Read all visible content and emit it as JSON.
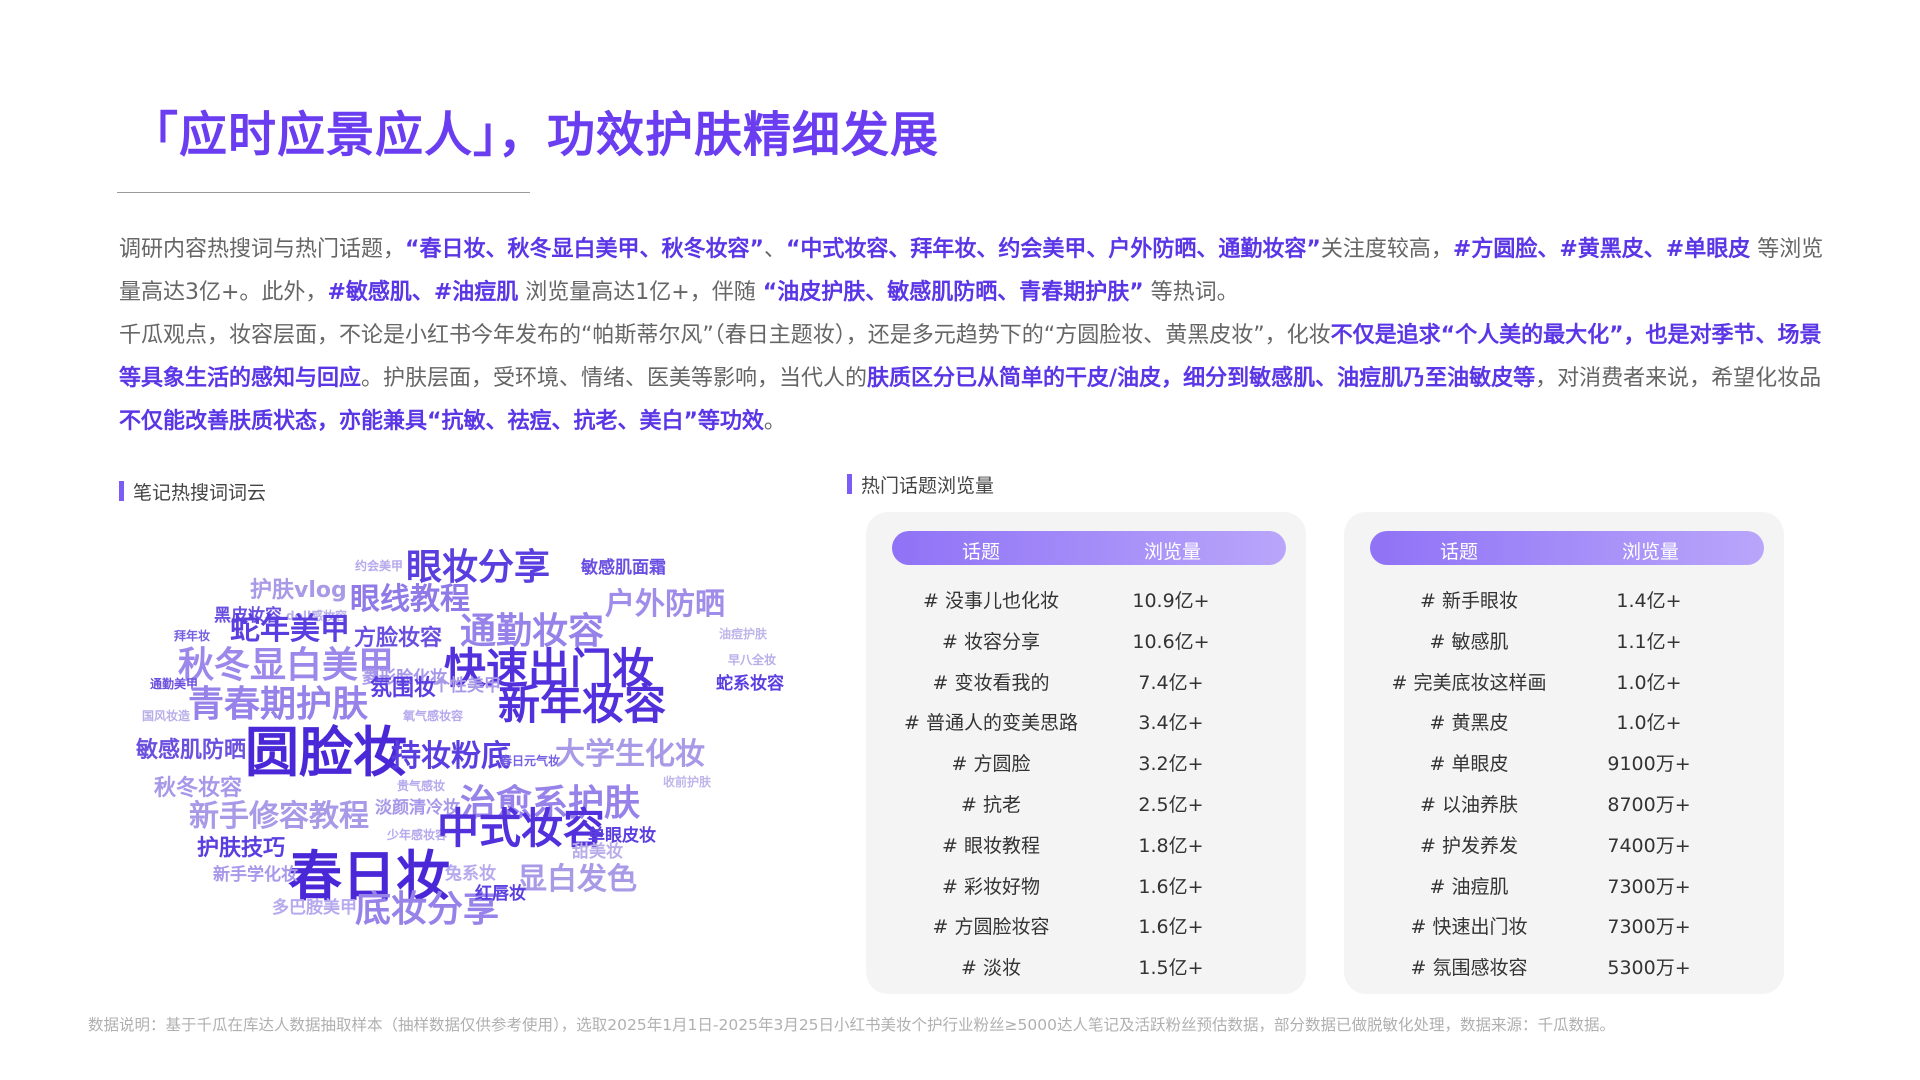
{
  "title": "「应时应景应人」，功效护肤精细发展",
  "intro": {
    "p1": [
      {
        "t": "调研内容热搜词与热门话题，",
        "hl": false
      },
      {
        "t": "“春日妆、秋冬显白美甲、秋冬妆容”",
        "hl": true
      },
      {
        "t": "、",
        "hl": false
      },
      {
        "t": "“中式妆容、拜年妆、约会美甲、户外防晒、通勤妆容”",
        "hl": true
      },
      {
        "t": "关注度较高，",
        "hl": false
      },
      {
        "t": "#方圆脸、#黄黑皮、#单眼皮",
        "hl": true
      },
      {
        "t": " 等浏览量高达3亿+。此外，",
        "hl": false
      },
      {
        "t": "#敏感肌、#油痘肌",
        "hl": true
      },
      {
        "t": " 浏览量高达1亿+，伴随 ",
        "hl": false
      },
      {
        "t": "“油皮护肤、敏感肌防晒、青春期护肤”",
        "hl": true
      },
      {
        "t": " 等热词。",
        "hl": false
      }
    ],
    "p2": [
      {
        "t": "千瓜观点，妆容层面，不论是小红书今年发布的“帕斯蒂尔风”（春日主题妆），还是多元趋势下的“方圆脸妆、黄黑皮妆”，化妆",
        "hl": false
      },
      {
        "t": "不仅是追求“个人美的最大化”，也是对季节、场景等具象生活的感知与回应",
        "hl": true
      },
      {
        "t": "。护肤层面，受环境、情绪、医美等影响，当代人的",
        "hl": false
      },
      {
        "t": "肤质区分已从简单的干皮/油皮，细分到敏感肌、油痘肌乃至油敏皮等",
        "hl": true
      },
      {
        "t": "，对消费者来说，希望化妆品",
        "hl": false
      },
      {
        "t": "不仅能改善肤质状态，亦能兼具“抗敏、祛痘、抗老、美白”等功效",
        "hl": true
      },
      {
        "t": "。",
        "hl": false
      }
    ]
  },
  "cloud_label": "笔记热搜词词云",
  "topics_label": "热门话题浏览量",
  "word_cloud": [
    {
      "text": "眼妆分享",
      "color": "#5b3ee0",
      "level": 5
    },
    {
      "text": "约会美甲",
      "color": "#b6a9ee",
      "level": 1
    },
    {
      "text": "敏感肌面霜",
      "color": "#6a4fe2",
      "level": 2
    },
    {
      "text": "护肤vlog",
      "color": "#a99ae8",
      "level": 3
    },
    {
      "text": "眼线教程",
      "color": "#8f7ae8",
      "level": 4
    },
    {
      "text": "户外防晒",
      "color": "#a08de9",
      "level": 4
    },
    {
      "text": "黑皮妆容",
      "color": "#6b50e0",
      "level": 2
    },
    {
      "text": "doll感妆容",
      "color": "#b9afe9",
      "level": 1
    },
    {
      "text": "通勤妆容",
      "color": "#9682e9",
      "level": 5
    },
    {
      "text": "拜年妆",
      "color": "#7560e2",
      "level": 1
    },
    {
      "text": "蛇年美甲",
      "color": "#5b3ee0",
      "level": 4
    },
    {
      "text": "方脸妆容",
      "color": "#6b50e0",
      "level": 3
    },
    {
      "text": "油痘护肤",
      "color": "#c0b6ec",
      "level": 1
    },
    {
      "text": "秋冬显白美甲",
      "color": "#9c88ea",
      "level": 5
    },
    {
      "text": "菱形脸化妆",
      "color": "#a898ea",
      "level": 2
    },
    {
      "text": "快速出门妆",
      "color": "#5230dc",
      "level": 6
    },
    {
      "text": "早八全妆",
      "color": "#b9aeea",
      "level": 1
    },
    {
      "text": "通勤美甲",
      "color": "#6b50e0",
      "level": 1
    },
    {
      "text": "氛围妆",
      "color": "#5b3ee0",
      "level": 3
    },
    {
      "text": "个性美甲",
      "color": "#a99ae8",
      "level": 2
    },
    {
      "text": "蛇系妆容",
      "color": "#5b3ee0",
      "level": 2
    },
    {
      "text": "青春期护肤",
      "color": "#9682e9",
      "level": 5
    },
    {
      "text": "新年妆容",
      "color": "#5230dc",
      "level": 6
    },
    {
      "text": "国风妆造",
      "color": "#b9aeea",
      "level": 1
    },
    {
      "text": "氧气感妆容",
      "color": "#b6a9ee",
      "level": 1
    },
    {
      "text": "敏感肌防晒",
      "color": "#6b50e0",
      "level": 3
    },
    {
      "text": "圆脸妆",
      "color": "#4a28d8",
      "level": 7
    },
    {
      "text": "持妆粉底",
      "color": "#5b3ee0",
      "level": 4
    },
    {
      "text": "春日元气妆",
      "color": "#7560e2",
      "level": 1
    },
    {
      "text": "大学生化妆",
      "color": "#a99ae8",
      "level": 4
    },
    {
      "text": "秋冬妆容",
      "color": "#a898ea",
      "level": 3
    },
    {
      "text": "贵气感妆",
      "color": "#b6a9ee",
      "level": 1
    },
    {
      "text": "收前护肤",
      "color": "#c0b6ec",
      "level": 1
    },
    {
      "text": "淡颜清冷妆",
      "color": "#a898ea",
      "level": 2
    },
    {
      "text": "治愈系护肤",
      "color": "#9682e9",
      "level": 5
    },
    {
      "text": "新手修容教程",
      "color": "#a99ae8",
      "level": 4
    },
    {
      "text": "少年感妆容",
      "color": "#b6a9ee",
      "level": 1
    },
    {
      "text": "中式妆容",
      "color": "#5230dc",
      "level": 6
    },
    {
      "text": "单眼皮妆",
      "color": "#5b3ee0",
      "level": 2
    },
    {
      "text": "护肤技巧",
      "color": "#5b3ee0",
      "level": 3
    },
    {
      "text": "甜美妆",
      "color": "#b9aeea",
      "level": 2
    },
    {
      "text": "春日妆",
      "color": "#4a28d8",
      "level": 7
    },
    {
      "text": "新手学化妆",
      "color": "#a898ea",
      "level": 2
    },
    {
      "text": "兔系妆",
      "color": "#b6a9ee",
      "level": 2
    },
    {
      "text": "显白发色",
      "color": "#a99ae8",
      "level": 4
    },
    {
      "text": "多巴胺美甲",
      "color": "#b6a9ee",
      "level": 2
    },
    {
      "text": "底妆分享",
      "color": "#9682e9",
      "level": 5
    },
    {
      "text": "红唇妆",
      "color": "#5b3ee0",
      "level": 2
    }
  ],
  "table_headers": {
    "topic": "话题",
    "views": "浏览量"
  },
  "table_left": [
    {
      "topic": "# 没事儿也化妆",
      "views": "10.9亿+"
    },
    {
      "topic": "# 妆容分享",
      "views": "10.6亿+"
    },
    {
      "topic": "# 变妆看我的",
      "views": "7.4亿+"
    },
    {
      "topic": "# 普通人的变美思路",
      "views": "3.4亿+"
    },
    {
      "topic": "# 方圆脸",
      "views": "3.2亿+"
    },
    {
      "topic": "# 抗老",
      "views": "2.5亿+"
    },
    {
      "topic": "# 眼妆教程",
      "views": "1.8亿+"
    },
    {
      "topic": "# 彩妆好物",
      "views": "1.6亿+"
    },
    {
      "topic": "# 方圆脸妆容",
      "views": "1.6亿+"
    },
    {
      "topic": "# 淡妆",
      "views": "1.5亿+"
    }
  ],
  "table_right": [
    {
      "topic": "# 新手眼妆",
      "views": "1.4亿+"
    },
    {
      "topic": "# 敏感肌",
      "views": "1.1亿+"
    },
    {
      "topic": "# 完美底妆这样画",
      "views": "1.0亿+"
    },
    {
      "topic": "# 黄黑皮",
      "views": "1.0亿+"
    },
    {
      "topic": "# 单眼皮",
      "views": "9100万+"
    },
    {
      "topic": "# 以油养肤",
      "views": "8700万+"
    },
    {
      "topic": "# 护发养发",
      "views": "7400万+"
    },
    {
      "topic": "# 油痘肌",
      "views": "7300万+"
    },
    {
      "topic": "# 快速出门妆",
      "views": "7300万+"
    },
    {
      "topic": "# 氛围感妆容",
      "views": "5300万+"
    }
  ],
  "footnote": "数据说明：基于千瓜在库达人数据抽取样本（抽样数据仅供参考使用），选取2025年1月1日-2025年3月25日小红书美妆个护行业粉丝≥5000达人笔记及活跃粉丝预估数据，部分数据已做脱敏化处理，数据来源：千瓜数据。"
}
